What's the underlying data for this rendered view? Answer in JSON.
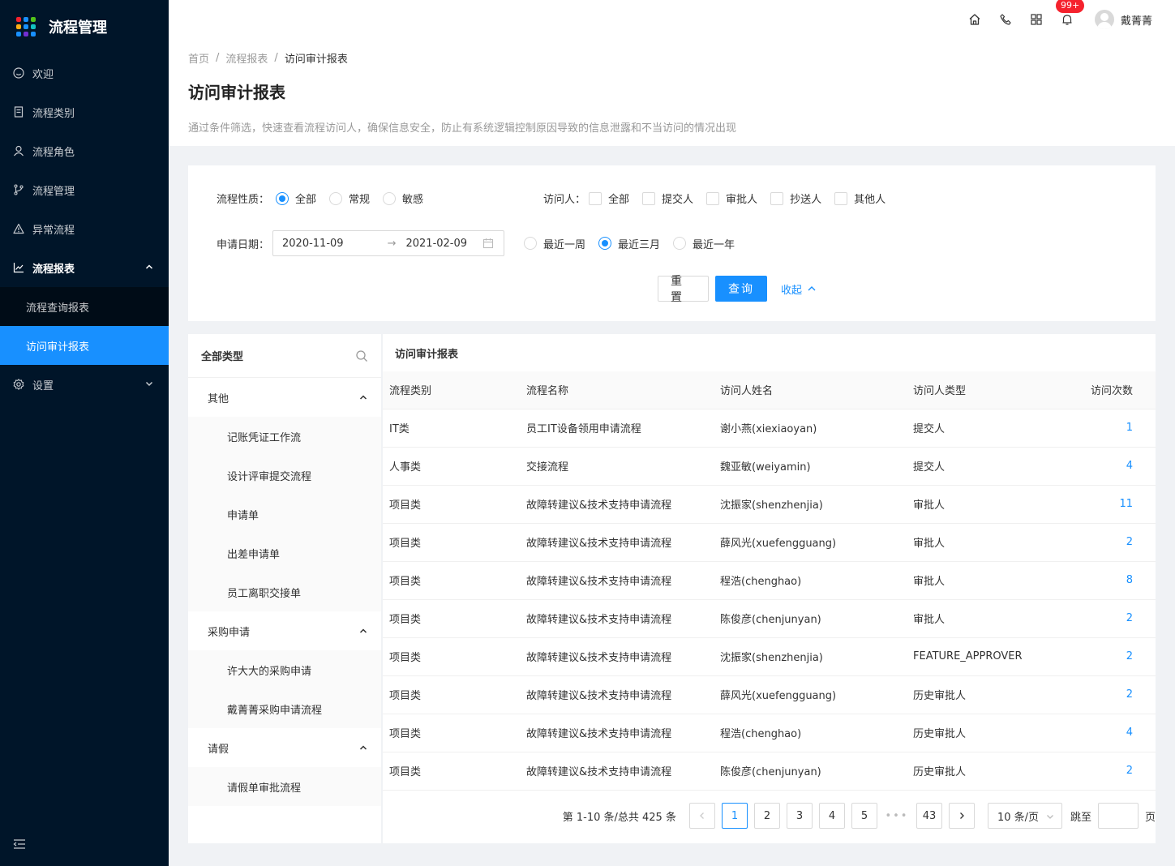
{
  "app": {
    "title": "流程管理",
    "logo_colors": [
      "#f5222d",
      "#1890ff",
      "#52c41a",
      "#faad14",
      "#1890ff",
      "#13c2c2",
      "#1890ff",
      "#722ed1",
      "#1890ff"
    ]
  },
  "sidebar": {
    "items": [
      {
        "label": "欢迎",
        "icon": "smile-icon"
      },
      {
        "label": "流程类别",
        "icon": "book-icon"
      },
      {
        "label": "流程角色",
        "icon": "user-icon"
      },
      {
        "label": "流程管理",
        "icon": "branch-icon"
      },
      {
        "label": "异常流程",
        "icon": "warning-icon"
      },
      {
        "label": "流程报表",
        "icon": "line-chart-icon",
        "open": true
      },
      {
        "label": "设置",
        "icon": "setting-icon"
      }
    ],
    "submenu": [
      {
        "label": "流程查询报表"
      },
      {
        "label": "访问审计报表",
        "active": true
      }
    ]
  },
  "header": {
    "notification_badge": "99+",
    "user_name": "戴菁菁"
  },
  "page": {
    "breadcrumb": [
      "首页",
      "流程报表",
      "访问审计报表"
    ],
    "title": "访问审计报表",
    "description": "通过条件筛选，快速查看流程访问人，确保信息安全，防止有系统逻辑控制原因导致的信息泄露和不当访问的情况出现"
  },
  "filters": {
    "nature_label": "流程性质：",
    "nature_options": [
      "全部",
      "常规",
      "敏感"
    ],
    "nature_selected": "全部",
    "visitor_label": "访问人：",
    "visitor_options": [
      "全部",
      "提交人",
      "审批人",
      "抄送人",
      "其他人"
    ],
    "date_label": "申请日期：",
    "date_start": "2020-11-09",
    "date_end": "2021-02-09",
    "quick_ranges": [
      "最近一周",
      "最近三月",
      "最近一年"
    ],
    "quick_selected": "最近三月",
    "reset_label": "重置",
    "query_label": "查询",
    "collapse_label": "收起"
  },
  "tree": {
    "title": "全部类型",
    "groups": [
      {
        "label": "其他",
        "children": [
          "记账凭证工作流",
          "设计评审提交流程",
          "申请单",
          "出差申请单",
          "员工离职交接单"
        ]
      },
      {
        "label": "采购申请",
        "children": [
          "许大大的采购申请",
          "戴菁菁采购申请流程"
        ]
      },
      {
        "label": "请假",
        "children": [
          "请假单审批流程"
        ]
      }
    ]
  },
  "table": {
    "title": "访问审计报表",
    "columns": [
      "流程类别",
      "流程名称",
      "访问人姓名",
      "访问人类型",
      "访问次数"
    ],
    "rows": [
      [
        "IT类",
        "员工IT设备领用申请流程",
        "谢小燕(xiexiaoyan)",
        "提交人",
        "1"
      ],
      [
        "人事类",
        "交接流程",
        "魏亚敏(weiyamin)",
        "提交人",
        "4"
      ],
      [
        "项目类",
        "故障转建议&技术支持申请流程",
        "沈振家(shenzhenjia)",
        "审批人",
        "11"
      ],
      [
        "项目类",
        "故障转建议&技术支持申请流程",
        "薛风光(xuefengguang)",
        "审批人",
        "2"
      ],
      [
        "项目类",
        "故障转建议&技术支持申请流程",
        "程浩(chenghao)",
        "审批人",
        "8"
      ],
      [
        "项目类",
        "故障转建议&技术支持申请流程",
        "陈俊彦(chenjunyan)",
        "审批人",
        "2"
      ],
      [
        "项目类",
        "故障转建议&技术支持申请流程",
        "沈振家(shenzhenjia)",
        "FEATURE_APPROVER",
        "2"
      ],
      [
        "项目类",
        "故障转建议&技术支持申请流程",
        "薛风光(xuefengguang)",
        "历史审批人",
        "2"
      ],
      [
        "项目类",
        "故障转建议&技术支持申请流程",
        "程浩(chenghao)",
        "历史审批人",
        "4"
      ],
      [
        "项目类",
        "故障转建议&技术支持申请流程",
        "陈俊彦(chenjunyan)",
        "历史审批人",
        "2"
      ]
    ]
  },
  "pagination": {
    "total_text": "第 1-10 条/总共 425 条",
    "pages": [
      "1",
      "2",
      "3",
      "4",
      "5"
    ],
    "current": "1",
    "ellipsis": "•••",
    "last": "43",
    "page_size": "10 条/页",
    "jump_label": "跳至",
    "jump_suffix": "页"
  }
}
